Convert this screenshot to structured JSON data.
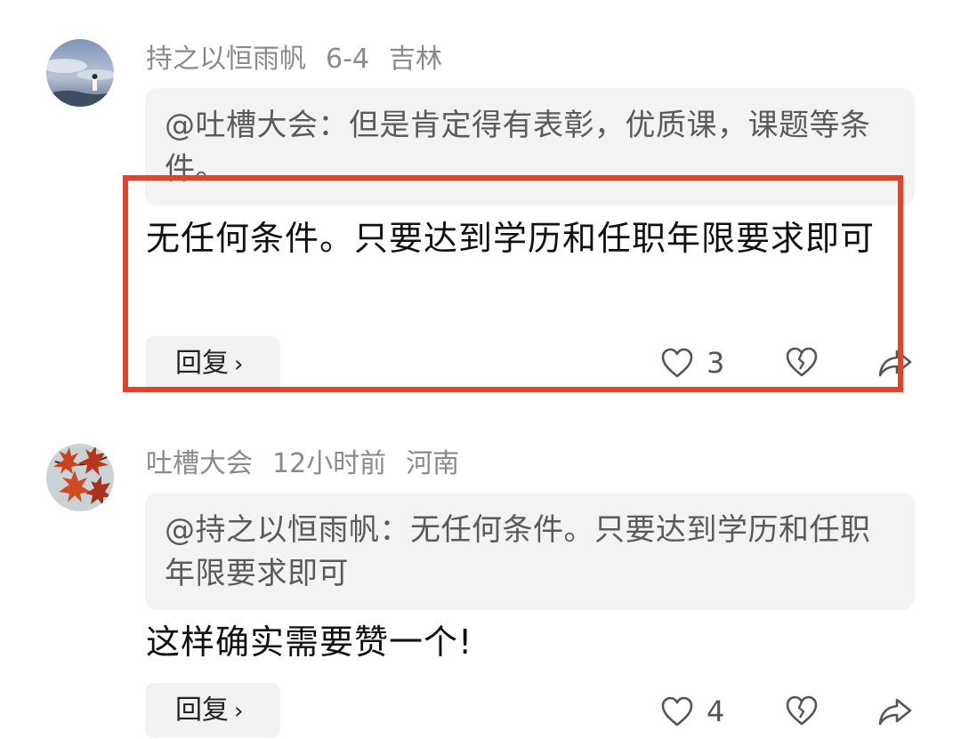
{
  "comments": [
    {
      "author": "持之以恒雨帆",
      "date": "6-4",
      "location": "吉林",
      "quote": "@吐槽大会：但是肯定得有表彰，优质课，课题等条件。",
      "text": "无任何条件。只要达到学历和任职年限要求即可",
      "reply_label": "回复",
      "reply_chevron": "›",
      "likes": "3"
    },
    {
      "author": "吐槽大会",
      "date": "12小时前",
      "location": "河南",
      "quote": "@持之以恒雨帆：无任何条件。只要达到学历和任职年限要求即可",
      "text": "这样确实需要赞一个!",
      "reply_label": "回复",
      "reply_chevron": "›",
      "likes": "4"
    }
  ],
  "colors": {
    "highlight": "#e3422b",
    "meta_text": "#8a8a8a",
    "quote_bg": "#f3f3f3"
  },
  "icons": [
    "heart-icon",
    "broken-heart-icon",
    "share-arrow-icon"
  ]
}
